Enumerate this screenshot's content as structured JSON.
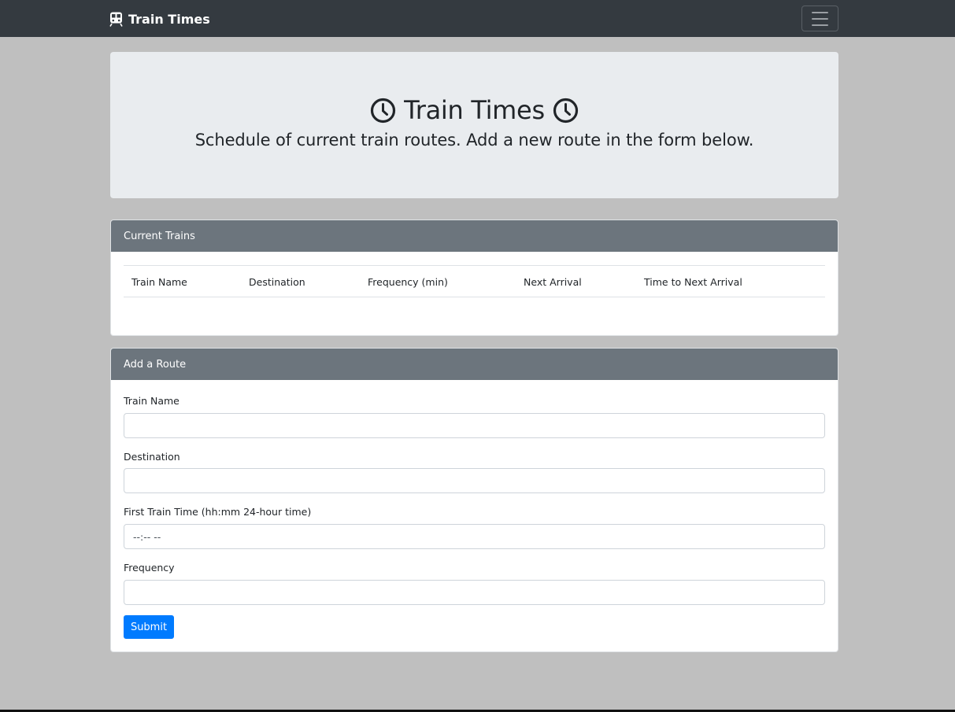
{
  "navbar": {
    "brand_icon": "train-icon",
    "brand_label": "Train Times",
    "toggler_icon": "hamburger-menu-icon"
  },
  "hero": {
    "title": "Train Times",
    "title_icon": "clock-icon",
    "subtitle": "Schedule of current train routes. Add a new route in the form below."
  },
  "current_trains": {
    "header": "Current Trains",
    "columns": [
      "Train Name",
      "Destination",
      "Frequency (min)",
      "Next Arrival",
      "Time to Next Arrival"
    ],
    "rows": []
  },
  "add_route": {
    "header": "Add a Route",
    "fields": [
      {
        "label": "Train Name",
        "value": "",
        "placeholder": ""
      },
      {
        "label": "Destination",
        "value": "",
        "placeholder": ""
      },
      {
        "label": "First Train Time (hh:mm 24-hour time)",
        "value": "",
        "placeholder": "--:-- --"
      },
      {
        "label": "Frequency",
        "value": "",
        "placeholder": ""
      }
    ],
    "submit_label": "Submit"
  },
  "colors": {
    "navbar_bg": "#343a40",
    "page_bg": "#bfbfbf",
    "jumbotron_bg": "#e9ecef",
    "card_header_bg": "#6c757d",
    "primary": "#007bff"
  }
}
